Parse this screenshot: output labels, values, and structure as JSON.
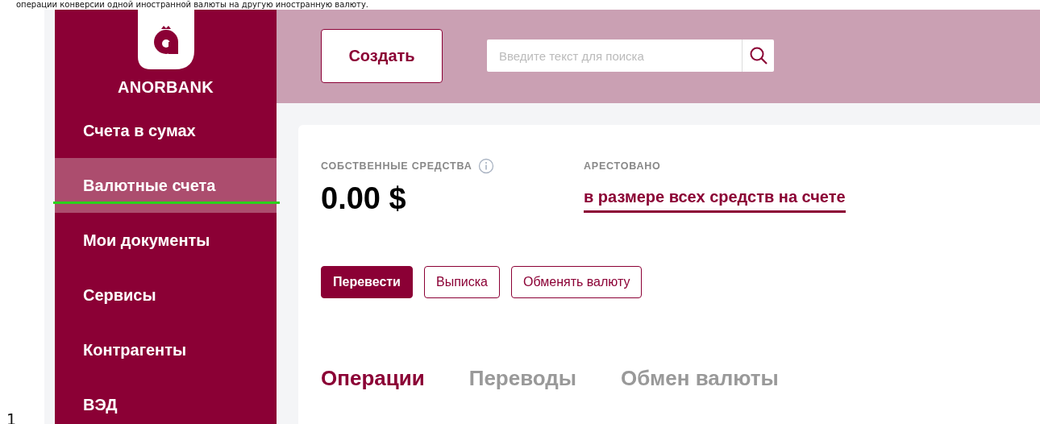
{
  "caption": "операции конверсии одной иностранной валюты на другую иностранную валюту.",
  "page_number": "1",
  "brand": "ANORBANK",
  "sidebar": {
    "items": [
      {
        "label": "Счета в сумах",
        "selected": false,
        "annotated": false
      },
      {
        "label": "Валютные счета",
        "selected": true,
        "annotated": true
      },
      {
        "label": "Мои документы",
        "selected": false,
        "annotated": false
      },
      {
        "label": "Сервисы",
        "selected": false,
        "annotated": false
      },
      {
        "label": "Контрагенты",
        "selected": false,
        "annotated": false
      },
      {
        "label": "ВЭД",
        "selected": false,
        "annotated": false
      }
    ]
  },
  "header": {
    "create_button": "Создать",
    "search": {
      "placeholder": "Введите текст для поиска"
    }
  },
  "balance": {
    "own_funds_label": "СОБСТВЕННЫЕ СРЕДСТВА",
    "own_funds": "0.00 $",
    "arrested_label": "АРЕСТОВАНО",
    "arrested": "в размере всех средств на счете"
  },
  "actions": [
    {
      "label": "Перевести",
      "kind": "primary"
    },
    {
      "label": "Выписка",
      "kind": "outline"
    },
    {
      "label": "Обменять валюту",
      "kind": "outline"
    }
  ],
  "tabs": [
    {
      "label": "Операции",
      "selected": true
    },
    {
      "label": "Переводы",
      "selected": false
    },
    {
      "label": "Обмен валюты",
      "selected": false
    }
  ]
}
